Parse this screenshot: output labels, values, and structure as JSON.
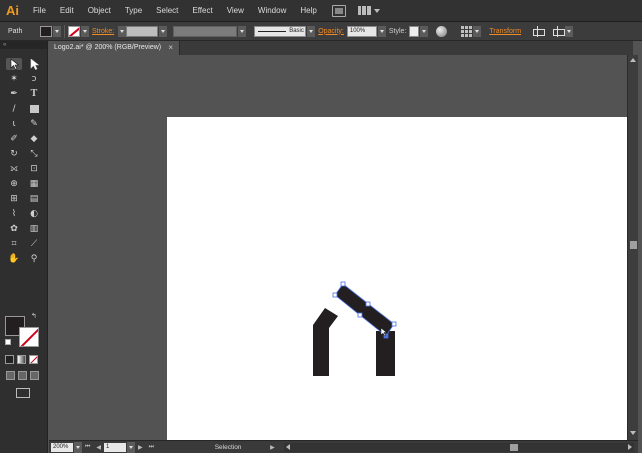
{
  "app": {
    "logo": "Ai"
  },
  "menu": [
    "File",
    "Edit",
    "Object",
    "Type",
    "Select",
    "Effect",
    "View",
    "Window",
    "Help"
  ],
  "control_bar": {
    "selection_type": "Path",
    "stroke_label": "Stroke:",
    "brush_label": "Basic",
    "opacity_label": "Opacity:",
    "opacity_value": "100%",
    "style_label": "Style:",
    "transform_label": "Transform"
  },
  "document_tab": {
    "title": "Logo2.ai* @ 200% (RGB/Preview)",
    "close": "×"
  },
  "colors": {
    "fill": "#231f20",
    "stroke": "none",
    "accent": "#f08a24",
    "selection": "#4a70e0"
  },
  "status_bar": {
    "zoom": "200%",
    "page": "1",
    "tool_status": "Selection"
  }
}
